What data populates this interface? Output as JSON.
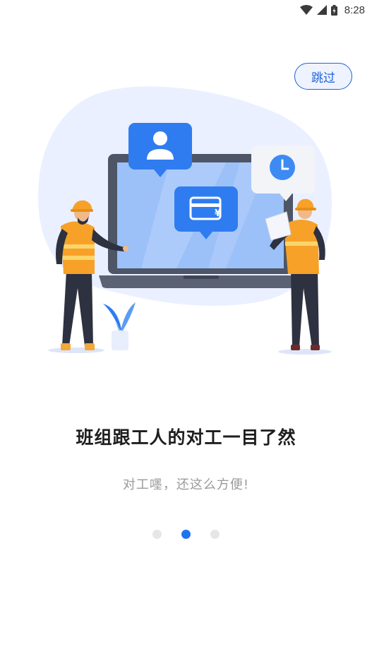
{
  "status_bar": {
    "time": "8:28"
  },
  "skip_button": {
    "label": "跳过"
  },
  "onboarding": {
    "headline": "班组跟工人的对工一目了然",
    "subtitle": "对工嚜，还这么方便!",
    "page_count": 3,
    "current_page": 2
  },
  "illustration": {
    "payment_symbol": "¥"
  },
  "colors": {
    "accent": "#1f74ee",
    "skip_border": "#1f63d6",
    "vest_orange": "#f7a128",
    "blob": "#eaf0ff"
  }
}
